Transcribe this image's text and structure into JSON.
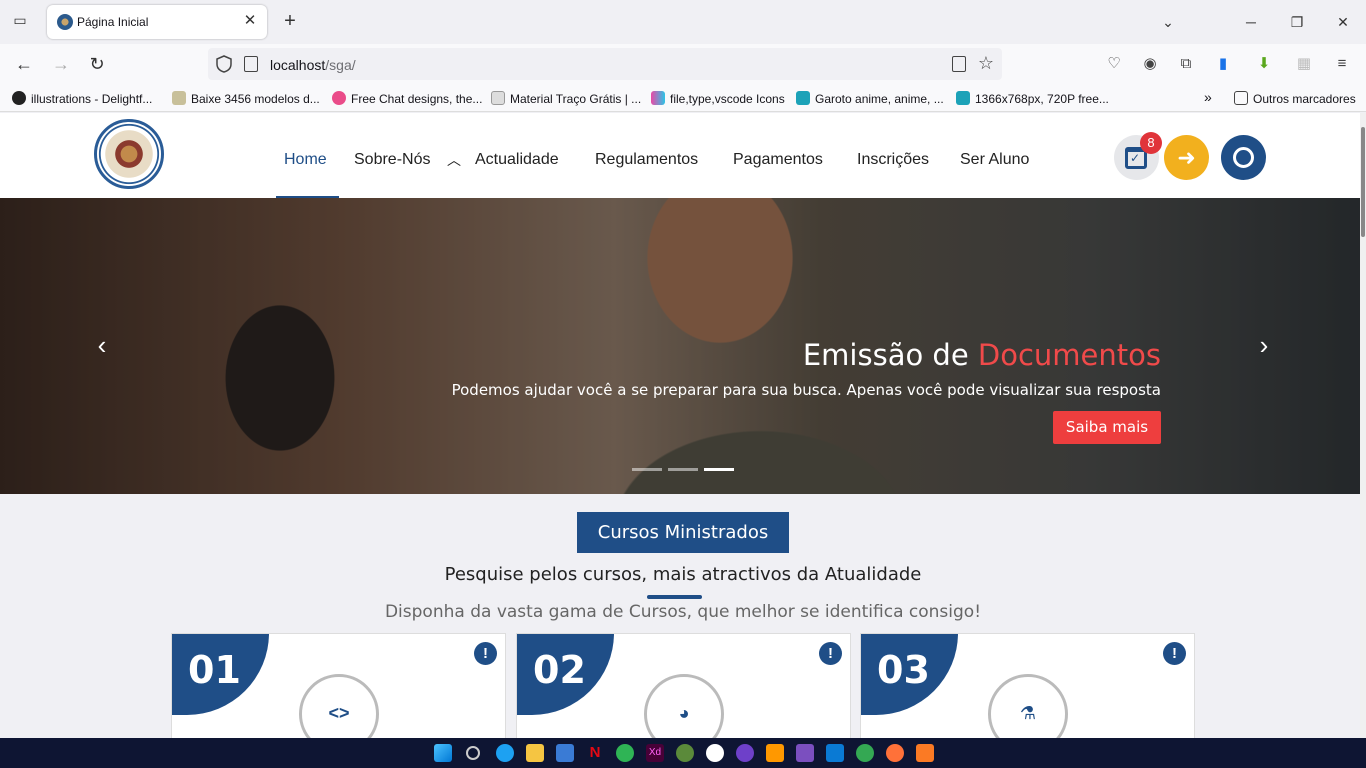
{
  "browser": {
    "tab_title": "Página Inicial",
    "url_host": "localhost",
    "url_path": "/sga/",
    "bookmarks": [
      "illustrations - Delightf...",
      "Baixe 3456 modelos d...",
      "Free Chat designs, the...",
      "Material Traço Grátis | ...",
      "file,type,vscode Icons",
      "Garoto anime, anime, ...",
      "1366x768px, 720P free..."
    ],
    "other_bookmarks": "Outros marcadores"
  },
  "site": {
    "menu": [
      "Home",
      "Sobre-Nós",
      "Actualidade",
      "Regulamentos",
      "Pagamentos",
      "Inscrições",
      "Ser Aluno"
    ],
    "notification_count": "8"
  },
  "hero": {
    "title_part1": "Emissão de ",
    "title_highlight": "Documentos",
    "subtitle": "Podemos ajudar você a se preparar para sua busca. Apenas você pode visualizar sua resposta",
    "cta": "Saiba mais",
    "active_slide": 3,
    "slide_count": 3
  },
  "section": {
    "button": "Cursos Ministrados",
    "title": "Pesquise pelos cursos, mais atractivos da Atualidade",
    "subtitle": "Disponha da vasta gama de Cursos, que melhor se identifica consigo!",
    "cards": [
      {
        "number": "01",
        "icon": "laptop-code-icon"
      },
      {
        "number": "02",
        "icon": "pie-chart-icon"
      },
      {
        "number": "03",
        "icon": "microscope-icon"
      }
    ]
  },
  "colors": {
    "primary": "#1f4e87",
    "accent": "#ee3e3e",
    "login": "#f2b01e"
  }
}
